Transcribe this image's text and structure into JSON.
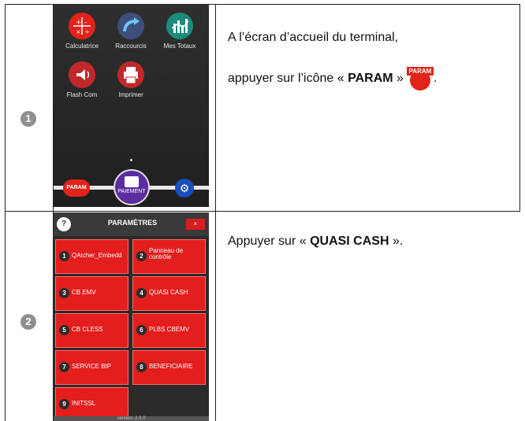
{
  "steps": [
    {
      "number": "1",
      "instruction_line1": "A l’écran d’accueil du terminal,",
      "instruction_line2_prefix": "appuyer sur l’icône « ",
      "instruction_line2_bold": "PARAM",
      "instruction_line2_suffix": " »",
      "instruction_trailing": ".",
      "inline_icon_label": "PARAM"
    },
    {
      "number": "2",
      "instruction_prefix": "Appuyer sur « ",
      "instruction_bold": "QUASI CASH",
      "instruction_suffix": " »."
    }
  ],
  "home_screen": {
    "apps": [
      {
        "label": "Calculatrice",
        "icon": "calculator-icon",
        "color": "#e2231a"
      },
      {
        "label": "Raccourcis",
        "icon": "shortcut-arrow-icon",
        "color": "#3d4f7a"
      },
      {
        "label": "Mes Totaux",
        "icon": "totals-chart-icon",
        "color": "#1e8a7d"
      },
      {
        "label": "Flash Com",
        "icon": "flash-com-icon",
        "color": "#c0282a"
      },
      {
        "label": "Imprimer",
        "icon": "printer-icon",
        "color": "#c0282a"
      }
    ],
    "dock": {
      "param_label": "PARAM",
      "payment_label": "PAIEMENT",
      "settings_icon": "gear-icon"
    }
  },
  "param_screen": {
    "title": "PARAMÈTRES",
    "help_label": "?",
    "close_label": "×",
    "tiles": [
      {
        "num": "1",
        "label": "QAtcher_Embedd"
      },
      {
        "num": "2",
        "label": "Panneau de contrôle"
      },
      {
        "num": "3",
        "label": "CB EMV"
      },
      {
        "num": "4",
        "label": "QUASI CASH"
      },
      {
        "num": "5",
        "label": "CB CLESS"
      },
      {
        "num": "6",
        "label": "PLBS CBEMV"
      },
      {
        "num": "7",
        "label": "SERVICE BIP"
      },
      {
        "num": "8",
        "label": "BENEFICIAIRE"
      },
      {
        "num": "9",
        "label": "INITSSL"
      }
    ],
    "version": "version: 2.3.0"
  },
  "colors": {
    "accent_red": "#e2231a",
    "dark_bg": "#2b2b2b",
    "badge_grey": "#8f8f8f"
  }
}
